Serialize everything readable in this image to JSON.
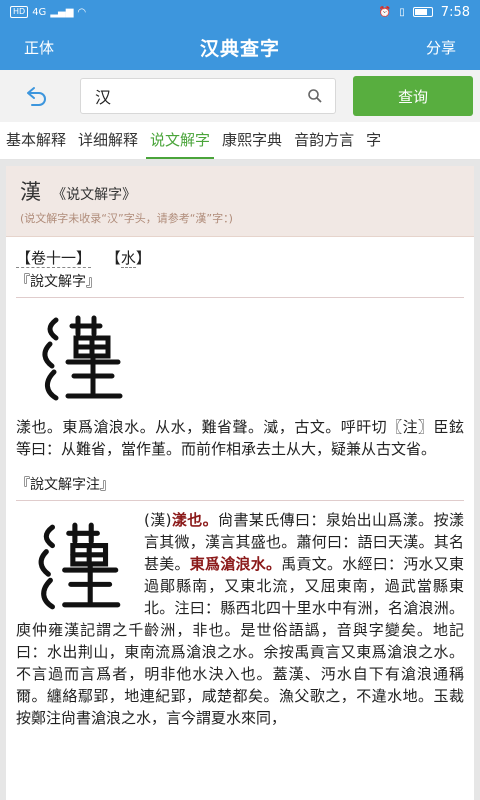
{
  "status": {
    "left": "4G",
    "hd": "HD",
    "time": "7:58"
  },
  "appbar": {
    "left_button": "正体",
    "title": "汉典查字",
    "right_button": "分享"
  },
  "search": {
    "value": "汉",
    "button": "查询"
  },
  "tabs": [
    "基本解释",
    "详细解释",
    "说文解字",
    "康熙字典",
    "音韵方言",
    "字"
  ],
  "active_tab_index": 2,
  "card": {
    "char": "漢",
    "source": "《说文解字》",
    "note": "(说文解字未收录“汉”字头，请参考“漢”字：)",
    "volume": "【卷十一】",
    "radical_open": "【",
    "radical": "水",
    "radical_close": "】",
    "section1_title": "『說文解字』",
    "seal1_icon": "seal-script-han-glyph",
    "para1": "漾也。東爲滄浪水。从水，難省聲。㵄，古文。呼旰切〖注〗臣鉉等曰：从難省，當作堇。而前作相承去土从大，疑兼从古文省。",
    "section2_title": "『說文解字注』",
    "seal2_icon": "seal-script-han-glyph",
    "para2_pre": "(漢)",
    "para2_red1": "漾也。",
    "para2_mid": "尙書某氏傳曰：泉始出山爲漾。按漾言其微，漢言其盛也。蕭何曰：語曰天漢。其名甚美。",
    "para2_red2": "東爲滄浪水。",
    "para2_post": "禹貢文。水經曰：沔水又東過鄖縣南，又東北流，又屈東南，過武當縣東北。注曰：縣西北四十里水中有洲，名滄浪洲。庾仲雍漢記謂之千齡洲，非也。是世俗語譌，音與字變矣。地記曰：水出荆山，東南流爲滄浪之水。余按禹貢言又東爲滄浪之水。不言過而言爲者，明非他水決入也。蓋漢、沔水自下有滄浪通稱爾。纏絡鄢郢，地連紀郢，咸楚都矣。漁父歌之，不違水地。玉裁按鄭注尙書滄浪之水，言今謂夏水來同，"
  }
}
